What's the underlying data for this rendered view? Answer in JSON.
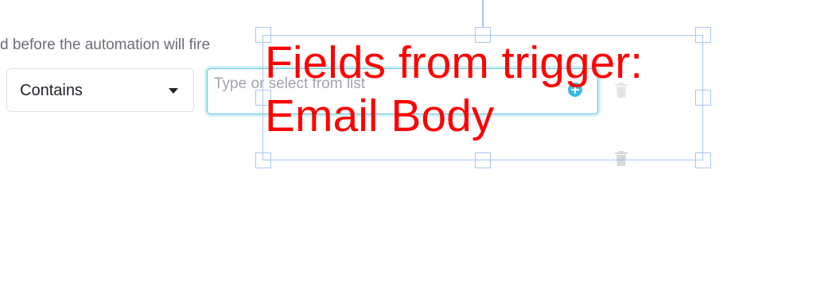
{
  "condition_row": {
    "helper_text": "d before the automation will fire",
    "operator_select": {
      "selected": "Contains"
    },
    "value_input": {
      "value": "",
      "placeholder": "Type or select from list"
    }
  },
  "icons": {
    "add": "add-circle-icon",
    "delete": "trash-icon"
  },
  "annotation": {
    "text": "Fields from trigger:\nEmail Body",
    "color": "#ff0000"
  },
  "colors": {
    "input_focus_border": "#5fc6db",
    "add_icon": "#3fb9e6",
    "selection_frame": "#a9c6f5"
  }
}
